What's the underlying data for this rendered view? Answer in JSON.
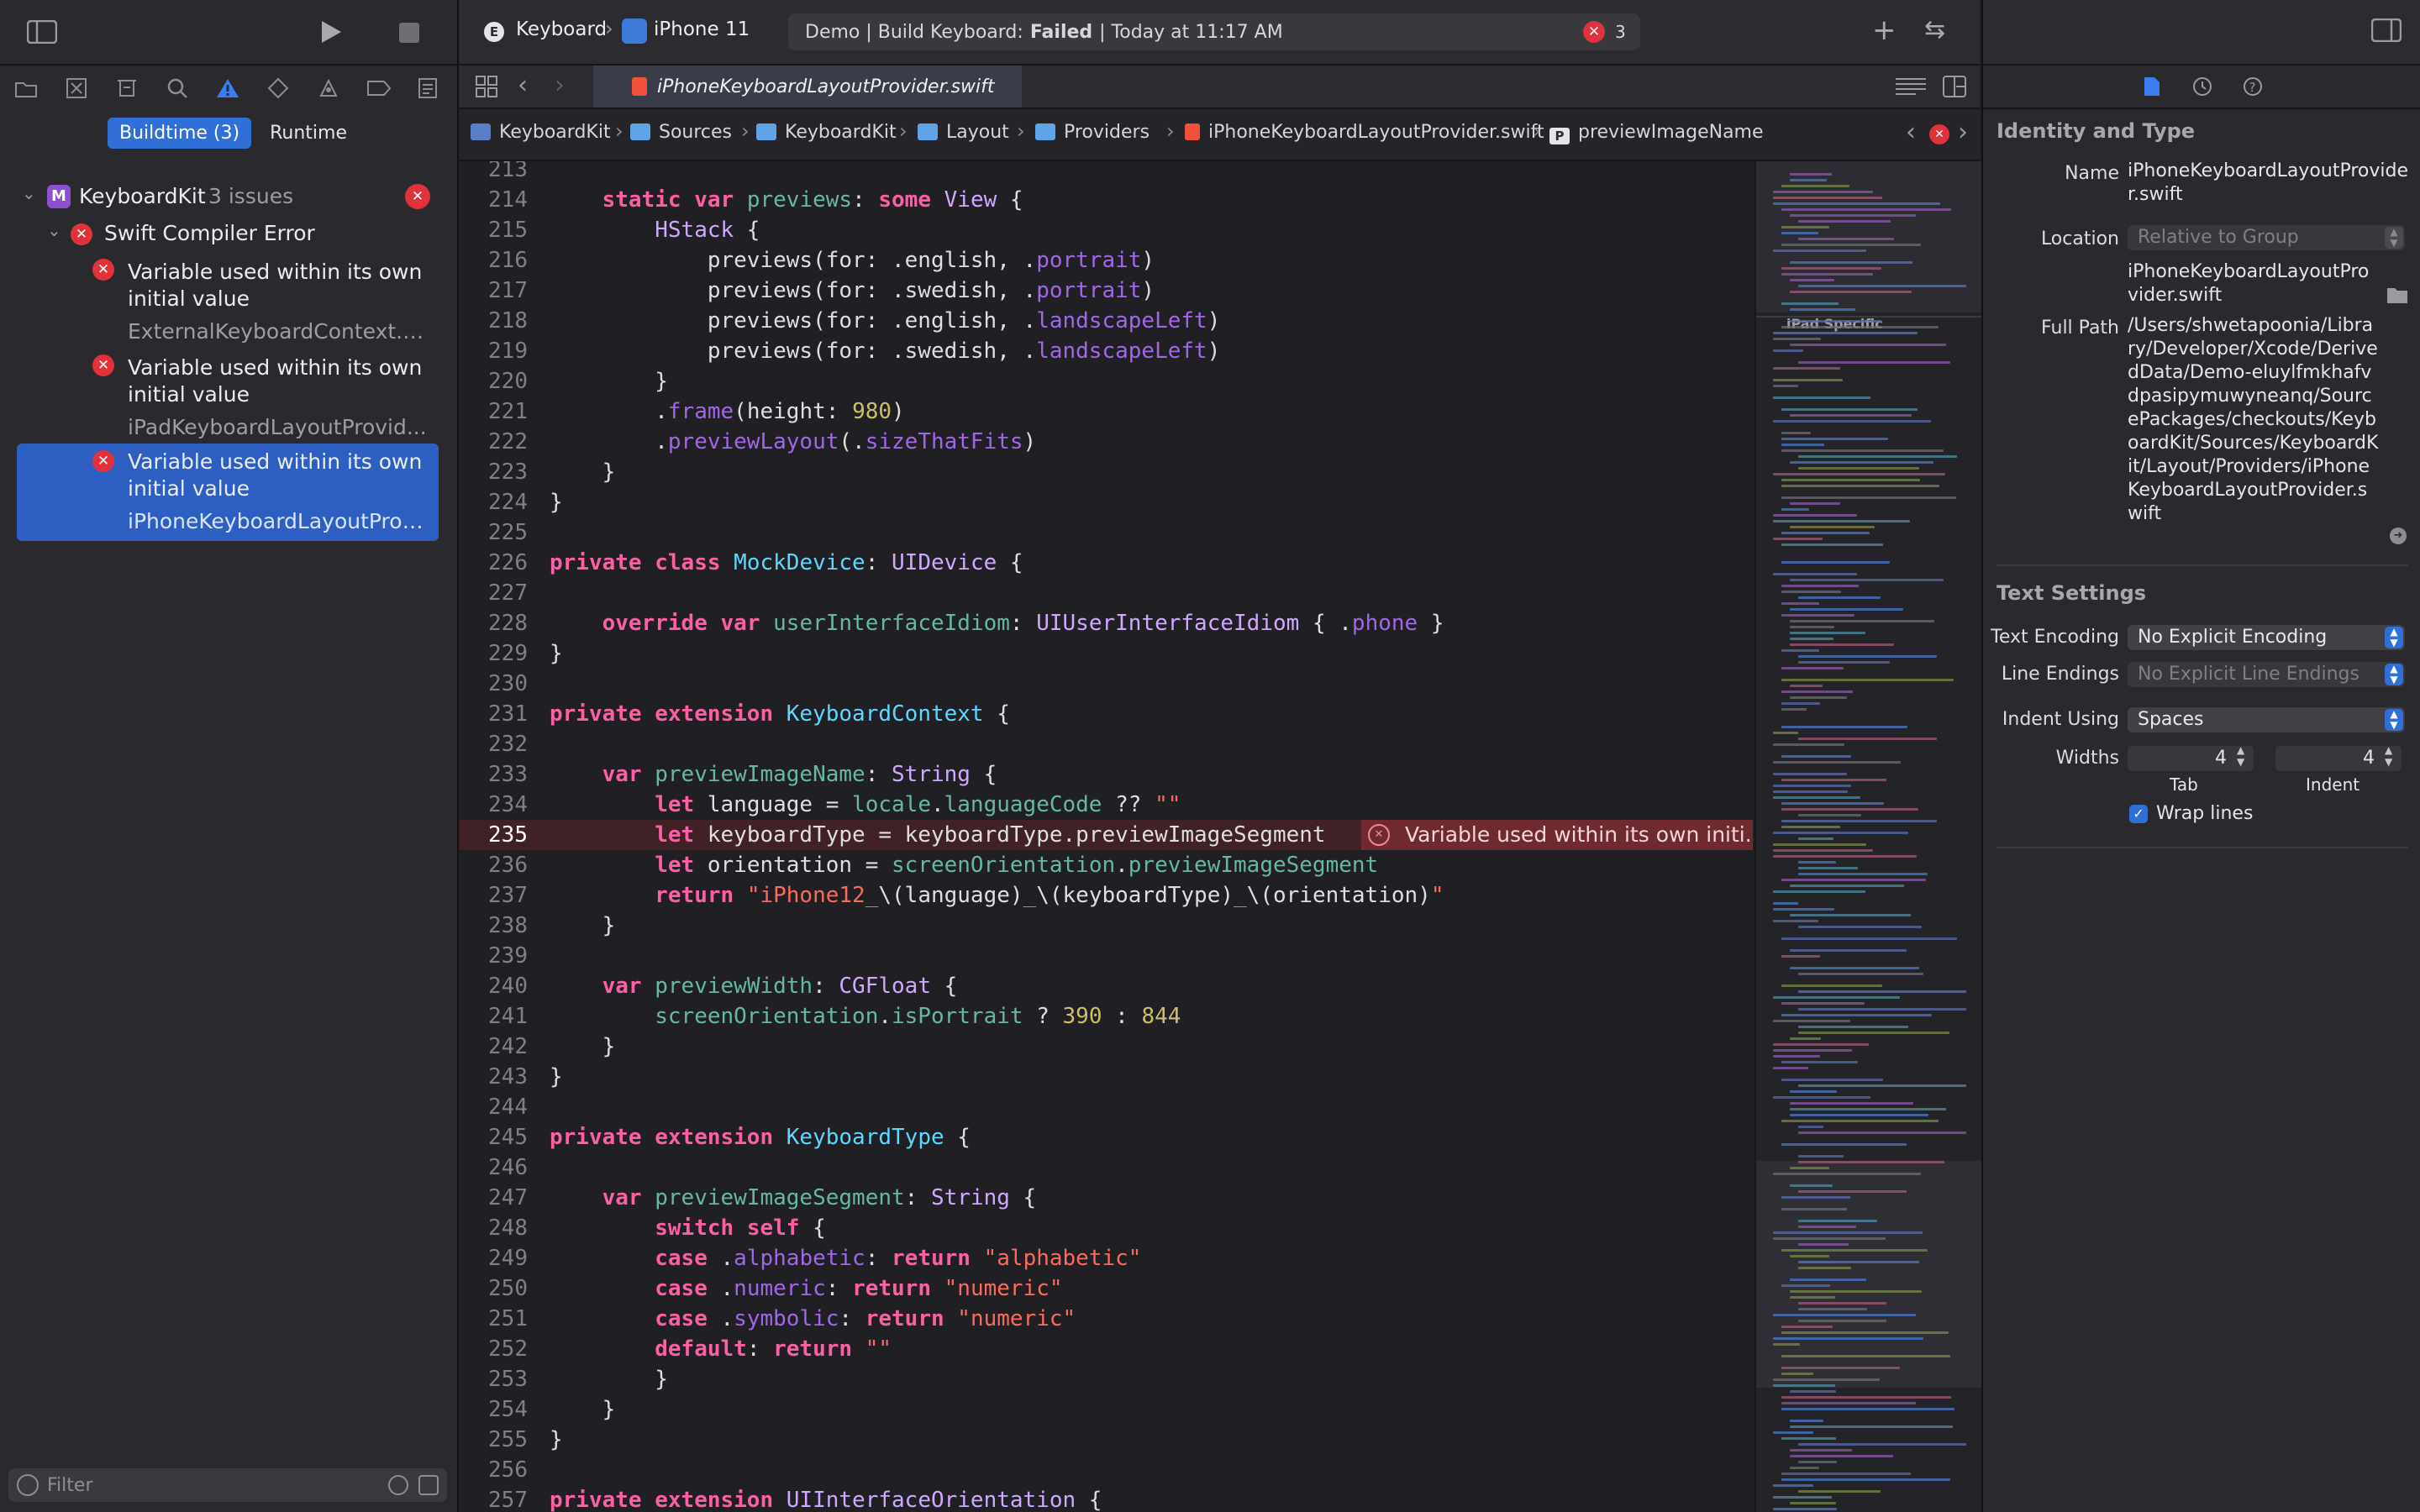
{
  "navigator": {
    "segments": {
      "buildtime": "Buildtime (3)",
      "runtime": "Runtime"
    },
    "project": {
      "name": "KeyboardKit",
      "issues": "3 issues"
    },
    "group": "Swift Compiler Error",
    "issues": [
      {
        "title": "Variable used within its own initial value",
        "file": "ExternalKeyboardContext.s..."
      },
      {
        "title": "Variable used within its own initial value",
        "file": "iPadKeyboardLayoutProvid..."
      },
      {
        "title": "Variable used within its own initial value",
        "file": "iPhoneKeyboardLayoutProv..."
      }
    ],
    "filter_placeholder": "Filter"
  },
  "toolbar": {
    "scheme": "Keyboard",
    "destination": "iPhone 11",
    "status_prefix": "Demo | Build Keyboard:",
    "status_result": "Failed",
    "status_time": "| Today at 11:17 AM",
    "error_count": "3"
  },
  "tab": {
    "filename": "iPhoneKeyboardLayoutProvider.swift"
  },
  "jumpbar": [
    "KeyboardKit",
    "Sources",
    "KeyboardKit",
    "Layout",
    "Providers",
    "iPhoneKeyboardLayoutProvider.swift",
    "previewImageName"
  ],
  "editor": {
    "error_annotation": "Variable used within its own initi...",
    "minimap_label": "iPad Specific",
    "line_numbers": [
      "213",
      "214",
      "215",
      "216",
      "217",
      "218",
      "219",
      "220",
      "221",
      "222",
      "223",
      "224",
      "225",
      "226",
      "227",
      "228",
      "229",
      "230",
      "231",
      "232",
      "233",
      "234",
      "235",
      "236",
      "237",
      "238",
      "239",
      "240",
      "241",
      "242",
      "243",
      "244",
      "245",
      "246",
      "247",
      "248",
      "249",
      "250",
      "251",
      "252",
      "253",
      "254",
      "255",
      "256",
      "257"
    ]
  },
  "inspector": {
    "identity_title": "Identity and Type",
    "name_label": "Name",
    "name_value": "iPhoneKeyboardLayoutProvider.swift",
    "location_label": "Location",
    "location_value": "Relative to Group",
    "location_file": "iPhoneKeyboardLayoutProvider.swift",
    "fullpath_label": "Full Path",
    "fullpath_value": "/Users/shwetapoonia/Library/Developer/Xcode/DerivedData/Demo-eluylfmkhafvdpasipymuwyneanq/SourcePackages/checkouts/KeyboardKit/Sources/KeyboardKit/Layout/Providers/iPhoneKeyboardLayoutProvider.swift",
    "text_settings_title": "Text Settings",
    "encoding_label": "Text Encoding",
    "encoding_value": "No Explicit Encoding",
    "line_endings_label": "Line Endings",
    "line_endings_value": "No Explicit Line Endings",
    "indent_using_label": "Indent Using",
    "indent_using_value": "Spaces",
    "widths_label": "Widths",
    "tab_width": "4",
    "indent_width": "4",
    "tab_caption": "Tab",
    "indent_caption": "Indent",
    "wrap_label": "Wrap lines"
  },
  "colors": {
    "accent": "#2f6fd6",
    "error": "#e0323a",
    "keyword": "#fc5fa3",
    "type": "#5dd8ff",
    "string": "#fc6a5d",
    "number": "#d0bf69"
  }
}
